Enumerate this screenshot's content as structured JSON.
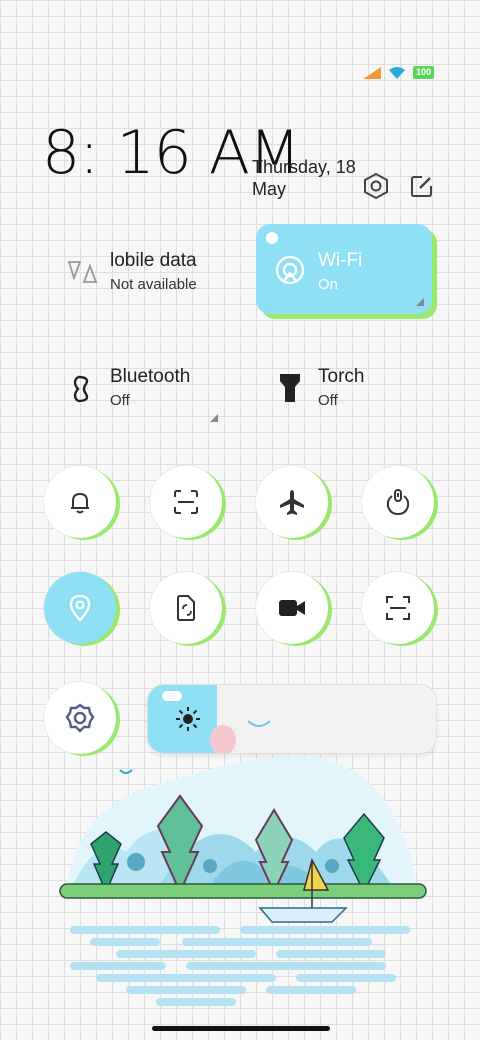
{
  "status_bar": {
    "battery_level": "100",
    "icons": [
      "signal-icon",
      "wifi-icon",
      "battery-icon"
    ]
  },
  "header": {
    "time": "8: 16 AM",
    "date": "Thursday, 18 May"
  },
  "tiles": {
    "mobile_data": {
      "label": "lobile data",
      "status": "Not available"
    },
    "wifi": {
      "label": "Wi-Fi",
      "status": "On"
    },
    "bluetooth": {
      "label": "Bluetooth",
      "status": "Off"
    },
    "torch": {
      "label": "Torch",
      "status": "Off"
    }
  },
  "toggles": [
    {
      "name": "ringer",
      "icon": "bell-icon",
      "active": false
    },
    {
      "name": "screenshot",
      "icon": "scan-icon",
      "active": false
    },
    {
      "name": "airplane",
      "icon": "airplane-icon",
      "active": false
    },
    {
      "name": "lock",
      "icon": "lock-icon",
      "active": false
    },
    {
      "name": "location",
      "icon": "location-icon",
      "active": true
    },
    {
      "name": "screen-share",
      "icon": "phone-rotate-icon",
      "active": false
    },
    {
      "name": "screen-record",
      "icon": "video-camera-icon",
      "active": false
    },
    {
      "name": "scanner",
      "icon": "scanner-icon",
      "active": false
    },
    {
      "name": "settings",
      "icon": "gear-icon",
      "active": false
    }
  ],
  "brightness": {
    "level": 0.24
  },
  "colors": {
    "accent": "#8fe0f5",
    "shadow_green": "#9ae86f",
    "wifi_tile": "#8fe0f5"
  }
}
